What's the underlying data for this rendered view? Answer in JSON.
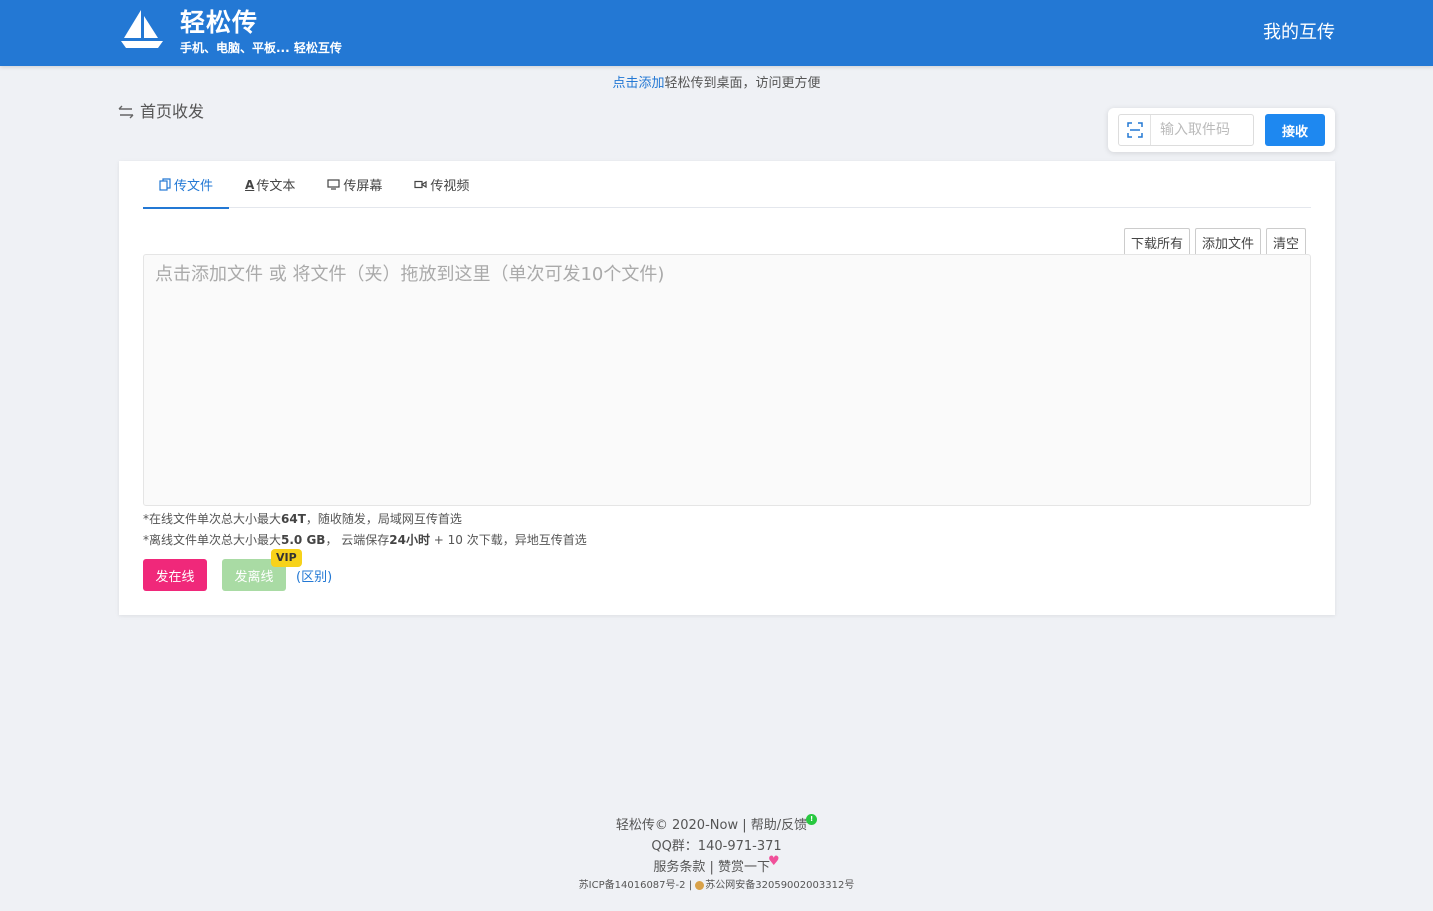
{
  "header": {
    "brand_title": "轻松传",
    "brand_subtitle": "手机、电脑、平板... 轻松互传",
    "my_transfer": "我的互传"
  },
  "notice": {
    "link_text": "点击添加",
    "rest_text": "轻松传到桌面，访问更方便"
  },
  "breadcrumb": {
    "icon": "swap-icon",
    "label": "首页收发"
  },
  "receive": {
    "placeholder": "输入取件码",
    "button_label": "接收",
    "scan_icon": "scan-icon"
  },
  "tabs": [
    {
      "label": "传文件",
      "icon": "copy-icon",
      "active": true
    },
    {
      "label": "传文本",
      "icon": "text-icon",
      "active": false
    },
    {
      "label": "传屏幕",
      "icon": "screen-icon",
      "active": false
    },
    {
      "label": "传视频",
      "icon": "video-icon",
      "active": false
    }
  ],
  "file_actions": {
    "download_all": "下载所有",
    "add_file": "添加文件",
    "clear": "清空"
  },
  "dropzone": {
    "hint": "点击添加文件 或 将文件（夹）拖放到这里（单次可发10个文件)"
  },
  "limits": {
    "online_prefix": "*在线文件单次总大小最大",
    "online_max": "64T",
    "online_suffix": "，随收随发，局域网互传首选",
    "offline_prefix": "*离线文件单次总大小最大",
    "offline_max": "5.0 GB",
    "offline_mid": "， 云端保存",
    "offline_keep": "24小时",
    "offline_suffix": " + 10 次下载，异地互传首选"
  },
  "send": {
    "online_label": "发在线",
    "offline_label": "发离线",
    "vip_badge": "VIP",
    "diff_link": "(区别)"
  },
  "footer": {
    "copyright": "轻松传© 2020-Now",
    "help": "帮助/反馈",
    "help_badge": "!",
    "qq": "QQ群：140-971-371",
    "terms": "服务条款",
    "donate": "赞赏一下",
    "icp": "苏ICP备14016087号-2",
    "police": "苏公网安备32059002003312号"
  },
  "colors": {
    "header_bg": "#2378d4",
    "accent": "#1e88f0",
    "send_online": "#f0287a",
    "send_offline": "#a9dba4",
    "vip": "#f7d21a"
  }
}
